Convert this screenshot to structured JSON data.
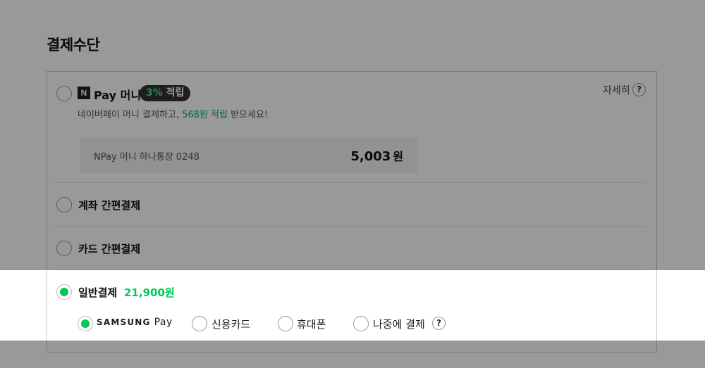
{
  "section_title": "결제수단",
  "npay": {
    "badge": "N",
    "title": "Pay 머니",
    "rate": "3%",
    "rate_suffix": "적립",
    "detail_link": "자세히",
    "help_icon": "?",
    "desc_prefix": "네이버페이 머니 결제하고,",
    "desc_highlight": "568원 적립",
    "desc_suffix": "받으세요!",
    "account_label": "NPay 머니 하나통장 0248",
    "balance": "5,003",
    "balance_unit": "원"
  },
  "options": [
    {
      "label": "계좌 간편결제",
      "checked": false
    },
    {
      "label": "카드 간편결제",
      "checked": false
    },
    {
      "label": "일반결제",
      "checked": true,
      "price": "21,900원"
    }
  ],
  "sub_methods": [
    {
      "brand": "SAMSUNG",
      "suffix": "Pay",
      "checked": true
    },
    {
      "label": "신용카드",
      "checked": false
    },
    {
      "label": "휴대폰",
      "checked": false
    },
    {
      "label": "나중에 결제",
      "checked": false,
      "help": "?"
    }
  ],
  "colors": {
    "accent": "#03c75a",
    "highlight_text": "#08b05c",
    "overlay": "rgba(0,0,0,0.40)"
  }
}
